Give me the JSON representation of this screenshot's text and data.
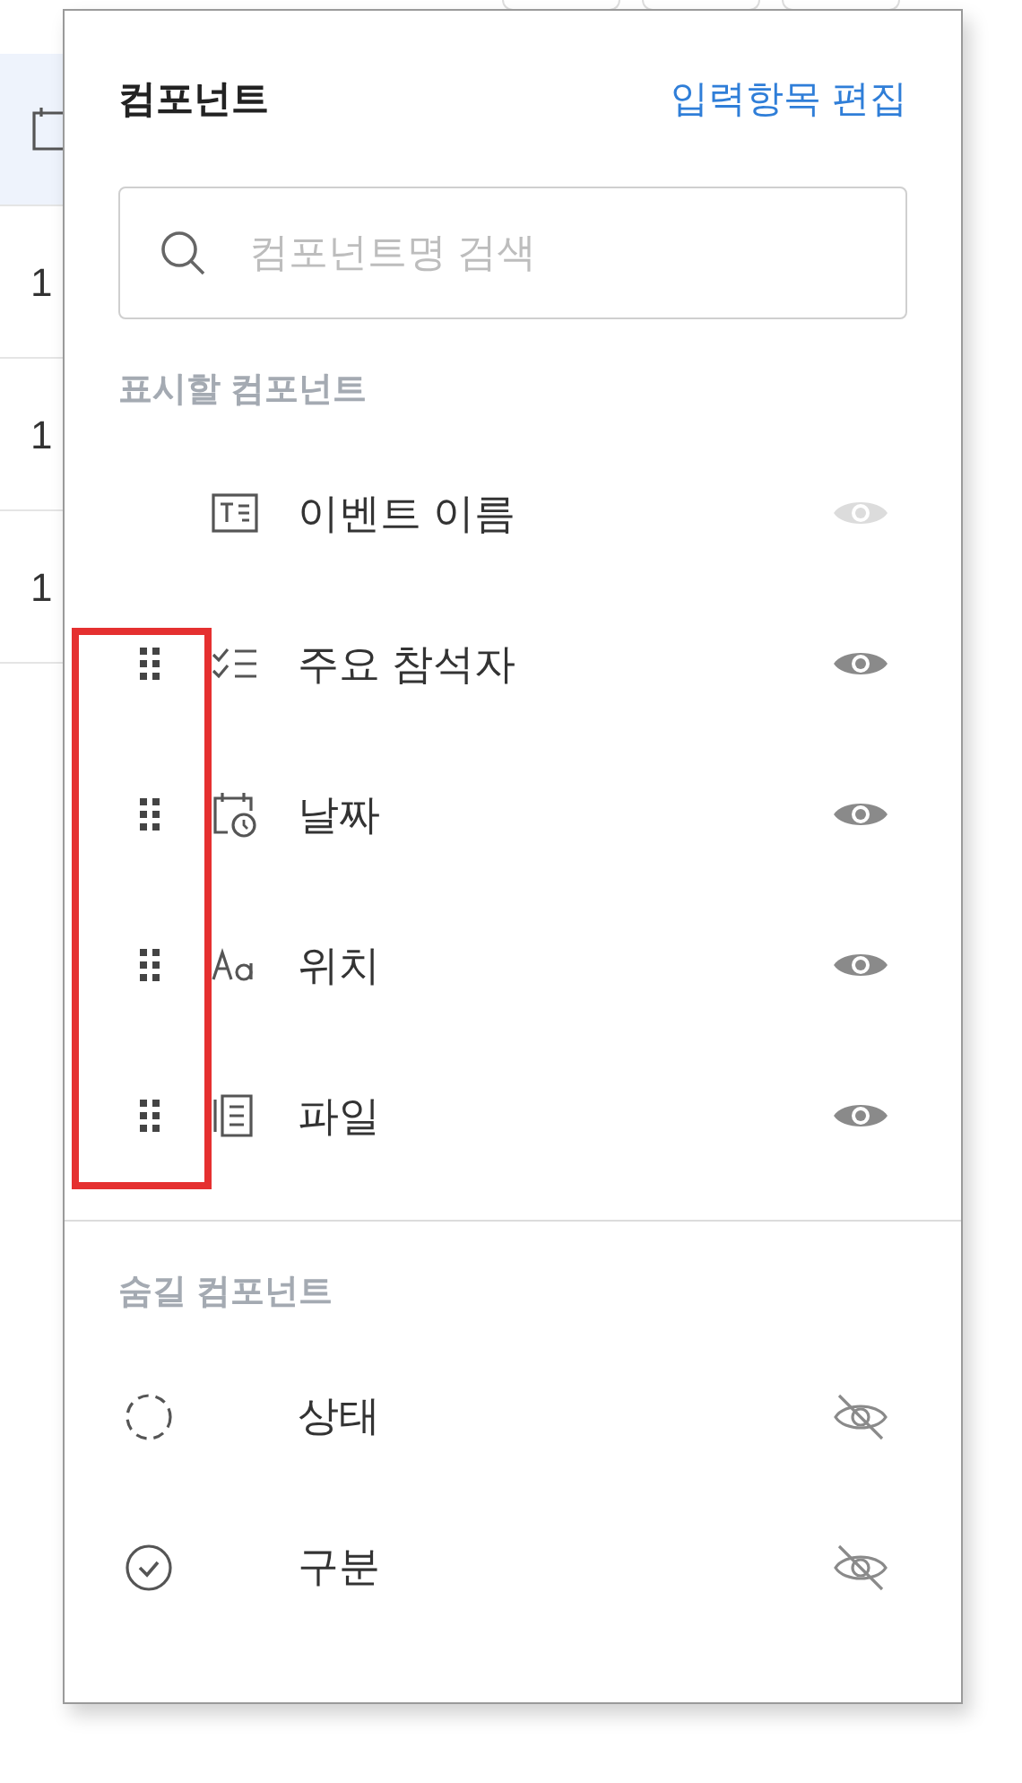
{
  "background_rows": [
    {
      "kind": "icon",
      "selected": true
    },
    {
      "cell": "1",
      "selected": false
    },
    {
      "cell": "1",
      "selected": false
    },
    {
      "cell": "1",
      "selected": false
    }
  ],
  "panel": {
    "title": "컴포넌트",
    "edit_link": "입력항목 편집",
    "search": {
      "placeholder": "컴포넌트명 검색"
    },
    "sections": [
      {
        "label": "표시할 컴포넌트",
        "items": [
          {
            "label": "이벤트 이름",
            "kind": "text",
            "draggable": false,
            "visible": true,
            "disabled": true
          },
          {
            "label": "주요 참석자",
            "kind": "people",
            "draggable": true,
            "visible": true,
            "disabled": false
          },
          {
            "label": "날짜",
            "kind": "date",
            "draggable": true,
            "visible": true,
            "disabled": false
          },
          {
            "label": "위치",
            "kind": "font",
            "draggable": true,
            "visible": true,
            "disabled": false
          },
          {
            "label": "파일",
            "kind": "file",
            "draggable": true,
            "visible": true,
            "disabled": false
          }
        ]
      },
      {
        "label": "숨길 컴포넌트",
        "items": [
          {
            "label": "상태",
            "kind": "status",
            "draggable": false,
            "visible": false,
            "disabled": false
          },
          {
            "label": "구분",
            "kind": "check",
            "draggable": false,
            "visible": false,
            "disabled": false
          }
        ]
      }
    ]
  }
}
